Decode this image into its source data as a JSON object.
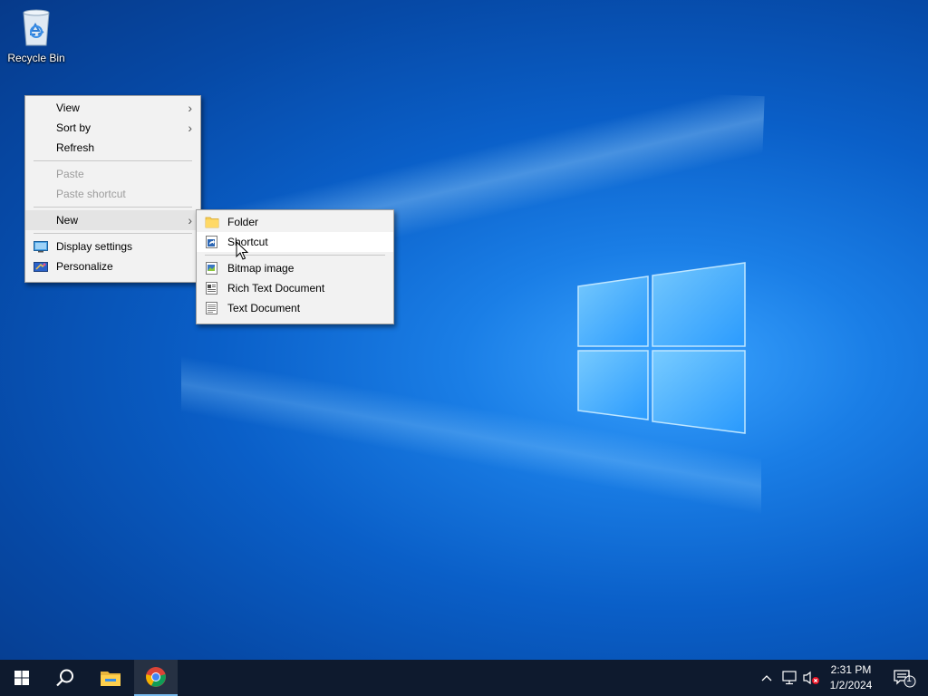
{
  "desktop": {
    "recycle_bin_label": "Recycle Bin"
  },
  "context_menu": {
    "items": [
      {
        "label": "View",
        "has_submenu": true
      },
      {
        "label": "Sort by",
        "has_submenu": true
      },
      {
        "label": "Refresh"
      },
      {
        "label": "Paste",
        "disabled": true
      },
      {
        "label": "Paste shortcut",
        "disabled": true
      },
      {
        "label": "New",
        "has_submenu": true,
        "highlighted": true
      },
      {
        "label": "Display settings",
        "icon": "display-icon"
      },
      {
        "label": "Personalize",
        "icon": "personalize-icon"
      }
    ]
  },
  "new_submenu": {
    "items": [
      {
        "label": "Folder",
        "icon": "folder-icon"
      },
      {
        "label": "Shortcut",
        "icon": "shortcut-icon",
        "highlighted": true
      },
      {
        "label": "Bitmap image",
        "icon": "bitmap-icon"
      },
      {
        "label": "Rich Text Document",
        "icon": "rtf-document-icon"
      },
      {
        "label": "Text Document",
        "icon": "text-document-icon"
      }
    ]
  },
  "taskbar": {
    "pinned": [
      "start-icon",
      "search-icon",
      "file-explorer-icon",
      "chrome-icon"
    ],
    "active_app": "chrome",
    "clock": {
      "time": "2:31 PM",
      "date": "1/2/2024"
    },
    "notification_count": "1"
  },
  "colors": {
    "taskbar_bg": "#0e1a2e",
    "menu_bg": "#f2f2f2",
    "accent": "#0078d7"
  }
}
